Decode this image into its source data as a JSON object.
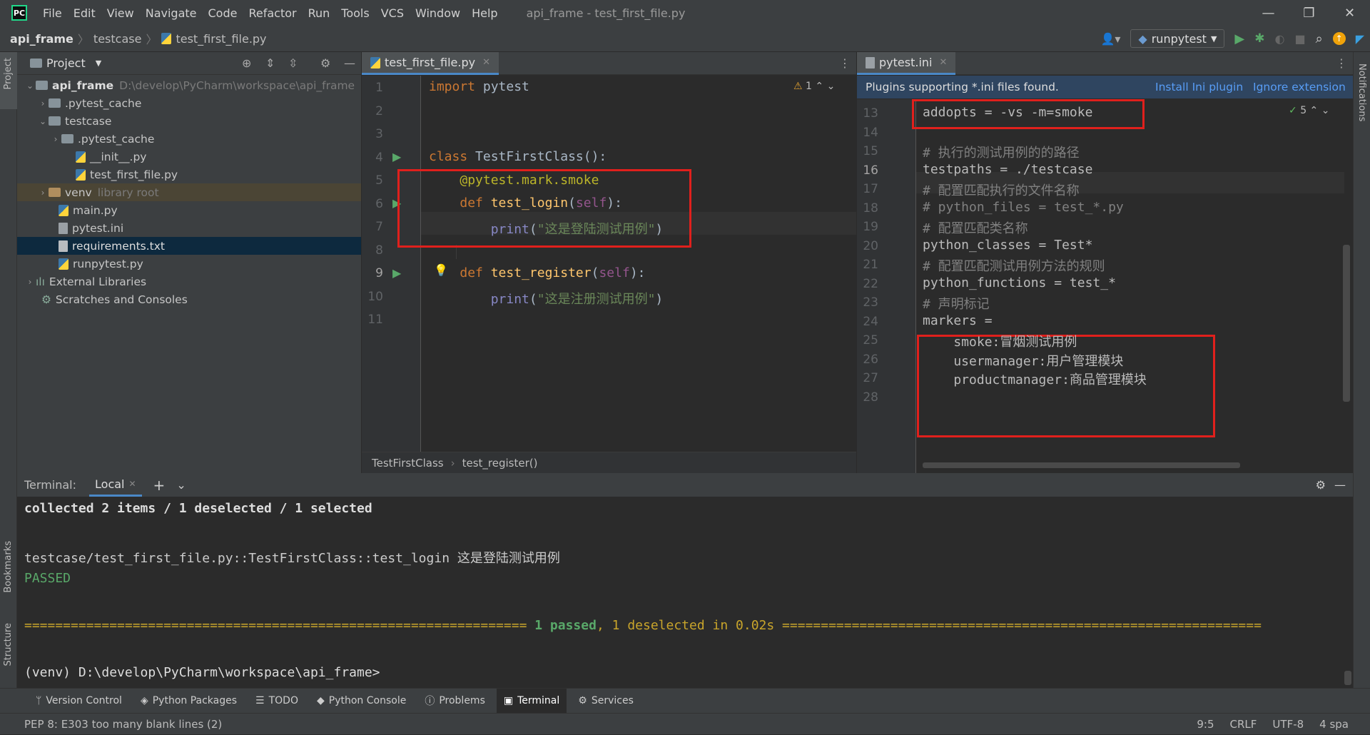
{
  "window": {
    "title": "api_frame - test_first_file.py",
    "menu": [
      "File",
      "Edit",
      "View",
      "Navigate",
      "Code",
      "Refactor",
      "Run",
      "Tools",
      "VCS",
      "Window",
      "Help"
    ]
  },
  "nav": {
    "crumbs": [
      "api_frame",
      "testcase",
      "test_first_file.py"
    ],
    "run_config": "runpytest"
  },
  "project": {
    "header": "Project",
    "items": [
      {
        "label": "api_frame",
        "extra": "D:\\develop\\PyCharm\\workspace\\api_frame"
      },
      {
        "label": ".pytest_cache"
      },
      {
        "label": "testcase"
      },
      {
        "label": ".pytest_cache"
      },
      {
        "label": "__init__.py"
      },
      {
        "label": "test_first_file.py"
      },
      {
        "label": "venv",
        "extra": "library root"
      },
      {
        "label": "main.py"
      },
      {
        "label": "pytest.ini"
      },
      {
        "label": "requirements.txt"
      },
      {
        "label": "runpytest.py"
      },
      {
        "label": "External Libraries"
      },
      {
        "label": "Scratches and Consoles"
      }
    ]
  },
  "editor1": {
    "tab": "test_first_file.py",
    "warnings": "1",
    "line_numbers": [
      "1",
      "2",
      "3",
      "4",
      "5",
      "6",
      "7",
      "8",
      "9",
      "10",
      "11"
    ],
    "breadcrumb": [
      "TestFirstClass",
      "test_register()"
    ]
  },
  "editor2": {
    "tab": "pytest.ini",
    "banner": "Plugins supporting *.ini files found.",
    "banner_install": "Install Ini plugin",
    "banner_ignore": "Ignore extension",
    "checks": "5",
    "line_numbers": [
      "13",
      "14",
      "15",
      "16",
      "17",
      "18",
      "19",
      "20",
      "21",
      "22",
      "23",
      "24",
      "25",
      "26",
      "27",
      "28"
    ],
    "lines": [
      "addopts = -vs -m=smoke",
      "",
      "# 执行的测试用例的的路径",
      "testpaths = ./testcase",
      "# 配置匹配执行的文件名称",
      "# python_files = test_*.py",
      "# 配置匹配类名称",
      "python_classes = Test*",
      "# 配置匹配测试用例方法的规则",
      "python_functions = test_*",
      "# 声明标记",
      "markers =",
      "    smoke:冒烟测试用例",
      "    usermanager:用户管理模块",
      "    productmanager:商品管理模块",
      ""
    ]
  },
  "terminal": {
    "label": "Terminal:",
    "tab": "Local",
    "lines": {
      "collected": "collected 2 items / 1 deselected / 1 selected",
      "test": "testcase/test_first_file.py::TestFirstClass::test_login 这是登陆测试用例",
      "passed": "PASSED",
      "summary_left": "================================================================= ",
      "summary_passed": "1 passed",
      "summary_mid": ", ",
      "summary_desel": "1 deselected in 0.02s",
      "summary_right": " ==============================================================",
      "prompt": "(venv) D:\\develop\\PyCharm\\workspace\\api_frame>"
    }
  },
  "toolwindows": [
    "Version Control",
    "Python Packages",
    "TODO",
    "Python Console",
    "Problems",
    "Terminal",
    "Services"
  ],
  "leftstrip": [
    "Project",
    "Bookmarks",
    "Structure"
  ],
  "rightstrip": [
    "Notifications"
  ],
  "status": {
    "message": "PEP 8: E303 too many blank lines (2)",
    "position": "9:5",
    "line_sep": "CRLF",
    "encoding": "UTF-8",
    "indent": "4 spa"
  }
}
